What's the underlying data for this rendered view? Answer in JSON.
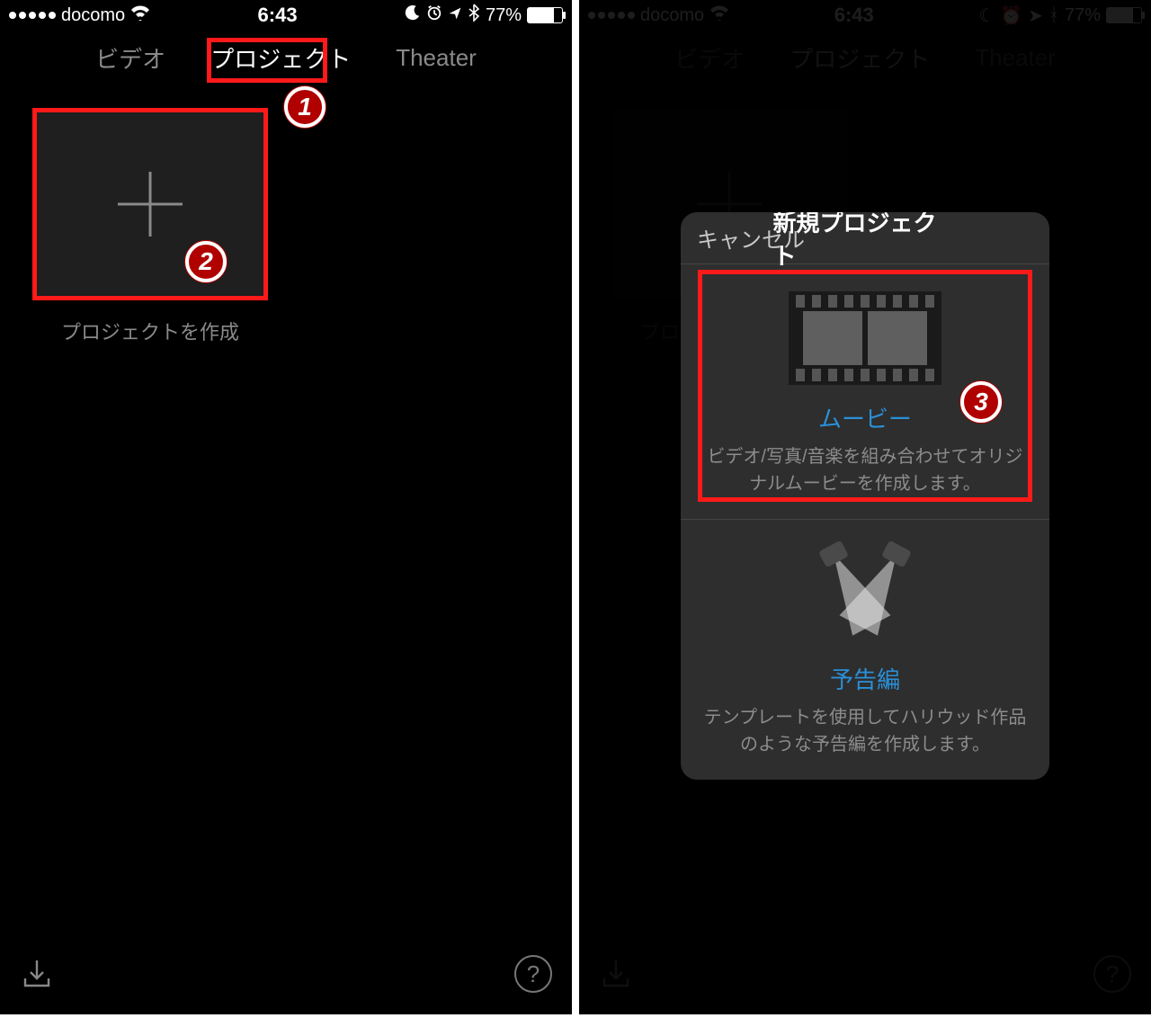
{
  "status": {
    "carrier": "docomo",
    "time": "6:43",
    "battery_pct": "77%"
  },
  "tabs": {
    "video": "ビデオ",
    "projects": "プロジェクト",
    "theater": "Theater"
  },
  "create": {
    "caption": "プロジェクトを作成"
  },
  "anno": {
    "n1": "1",
    "n2": "2",
    "n3": "3"
  },
  "modal": {
    "cancel": "キャンセル",
    "title": "新規プロジェクト",
    "movie": {
      "title": "ムービー",
      "desc": "ビデオ/写真/音楽を組み合わせてオリジナルムービーを作成します。"
    },
    "trailer": {
      "title": "予告編",
      "desc": "テンプレートを使用してハリウッド作品のような予告編を作成します。"
    }
  }
}
